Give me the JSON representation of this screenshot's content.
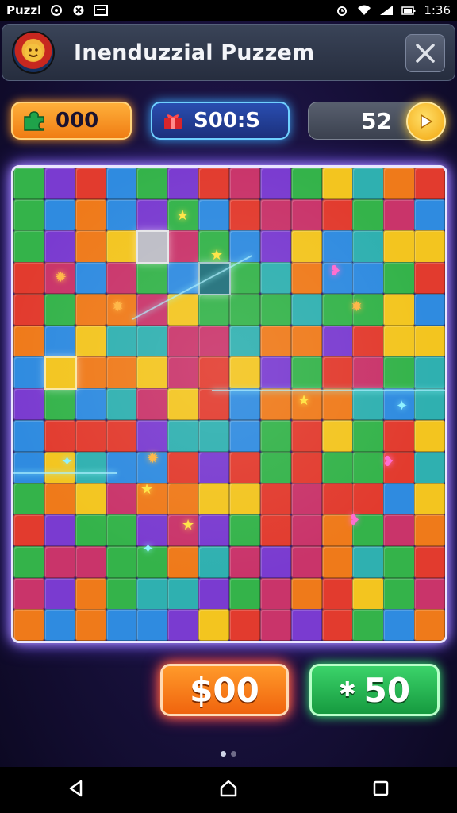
{
  "status_bar": {
    "app_name": "Puzzl",
    "time": "1:36",
    "icons": [
      "gamepad-icon",
      "no-sim-icon",
      "screenshot-icon",
      "alarm-icon",
      "wifi-icon",
      "signal-icon",
      "battery-icon"
    ]
  },
  "header": {
    "title": "Inenduzzial Puzzem",
    "icon": "puzzle-app-icon",
    "close_icon": "close-icon"
  },
  "hud": {
    "score": {
      "icon": "puzzle-piece-icon",
      "value": "000",
      "color": "#ff9a2a"
    },
    "coins": {
      "icon": "gift-icon",
      "value": "S00:S",
      "color": "#3ba8ff"
    },
    "level": {
      "value": "52"
    },
    "play_icon": "play-icon"
  },
  "board": {
    "palette": [
      "#e23b2e",
      "#2f8be0",
      "#f3c51f",
      "#34b34a",
      "#7a3bd0",
      "#ef7a1a",
      "#2fb0b0",
      "#c9346a"
    ],
    "sparkles": [
      {
        "icon": "star-icon",
        "color": "#ffe54a"
      },
      {
        "icon": "bug-icon",
        "color": "#ffb84a"
      },
      {
        "icon": "gem-icon",
        "color": "#8ff1ff"
      },
      {
        "icon": "heart-icon",
        "color": "#ff6fd0"
      }
    ]
  },
  "actions": {
    "buy_label": "$00",
    "bonus_icon": "asterisk-icon",
    "bonus_label": "50"
  },
  "pagination": {
    "pages": 2,
    "active": 0
  },
  "nav": {
    "back_icon": "back-icon",
    "home_icon": "home-icon",
    "recents_icon": "recents-icon"
  }
}
